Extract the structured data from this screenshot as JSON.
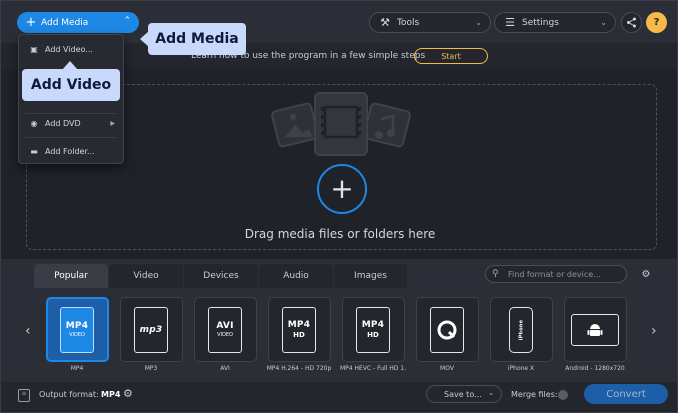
{
  "header": {
    "add_media_label": "Add Media",
    "tools_label": "Tools",
    "settings_label": "Settings",
    "help_label": "?"
  },
  "tutorial": {
    "text": "Learn how to use the program in a few simple steps",
    "start_label": "Start"
  },
  "dropzone": {
    "text": "Drag media files or folders here"
  },
  "dropdown": {
    "items": [
      {
        "label": "Add Video...",
        "icon": "film-icon"
      },
      {
        "label": "Add DVD",
        "icon": "disc-icon"
      },
      {
        "label": "Add Folder...",
        "icon": "folder-icon"
      }
    ]
  },
  "callouts": {
    "add_media": "Add Media",
    "add_video": "Add Video"
  },
  "format_tabs": [
    {
      "label": "Popular",
      "active": true
    },
    {
      "label": "Video",
      "active": false
    },
    {
      "label": "Devices",
      "active": false
    },
    {
      "label": "Audio",
      "active": false
    },
    {
      "label": "Images",
      "active": false
    }
  ],
  "search": {
    "placeholder": "Find format or device..."
  },
  "formats": [
    {
      "badge": "MP4",
      "sub": "VIDEO",
      "label": "MP4",
      "selected": true
    },
    {
      "badge": "mp3",
      "sub": "",
      "label": "MP3",
      "selected": false
    },
    {
      "badge": "AVI",
      "sub": "VIDEO",
      "label": "AVI",
      "selected": false
    },
    {
      "badge": "MP4",
      "sub": "HD",
      "label": "MP4 H.264 - HD 720p",
      "selected": false
    },
    {
      "badge": "MP4",
      "sub": "HD",
      "label": "MP4 HEVC - Full HD 1...",
      "selected": false
    },
    {
      "badge": "",
      "sub": "",
      "label": "MOV",
      "selected": false
    },
    {
      "badge": "iPhone",
      "sub": "",
      "label": "iPhone X",
      "selected": false
    },
    {
      "badge": "",
      "sub": "",
      "label": "Android - 1280x720",
      "selected": false
    }
  ],
  "bottom": {
    "output_label": "Output format:",
    "output_value": "MP4",
    "save_label": "Save to...",
    "merge_label": "Merge files:",
    "convert_label": "Convert"
  },
  "colors": {
    "accent": "#1e88e5",
    "highlight": "#f6b94a",
    "callout": "#c9d9fb",
    "background": "#1f2229"
  }
}
